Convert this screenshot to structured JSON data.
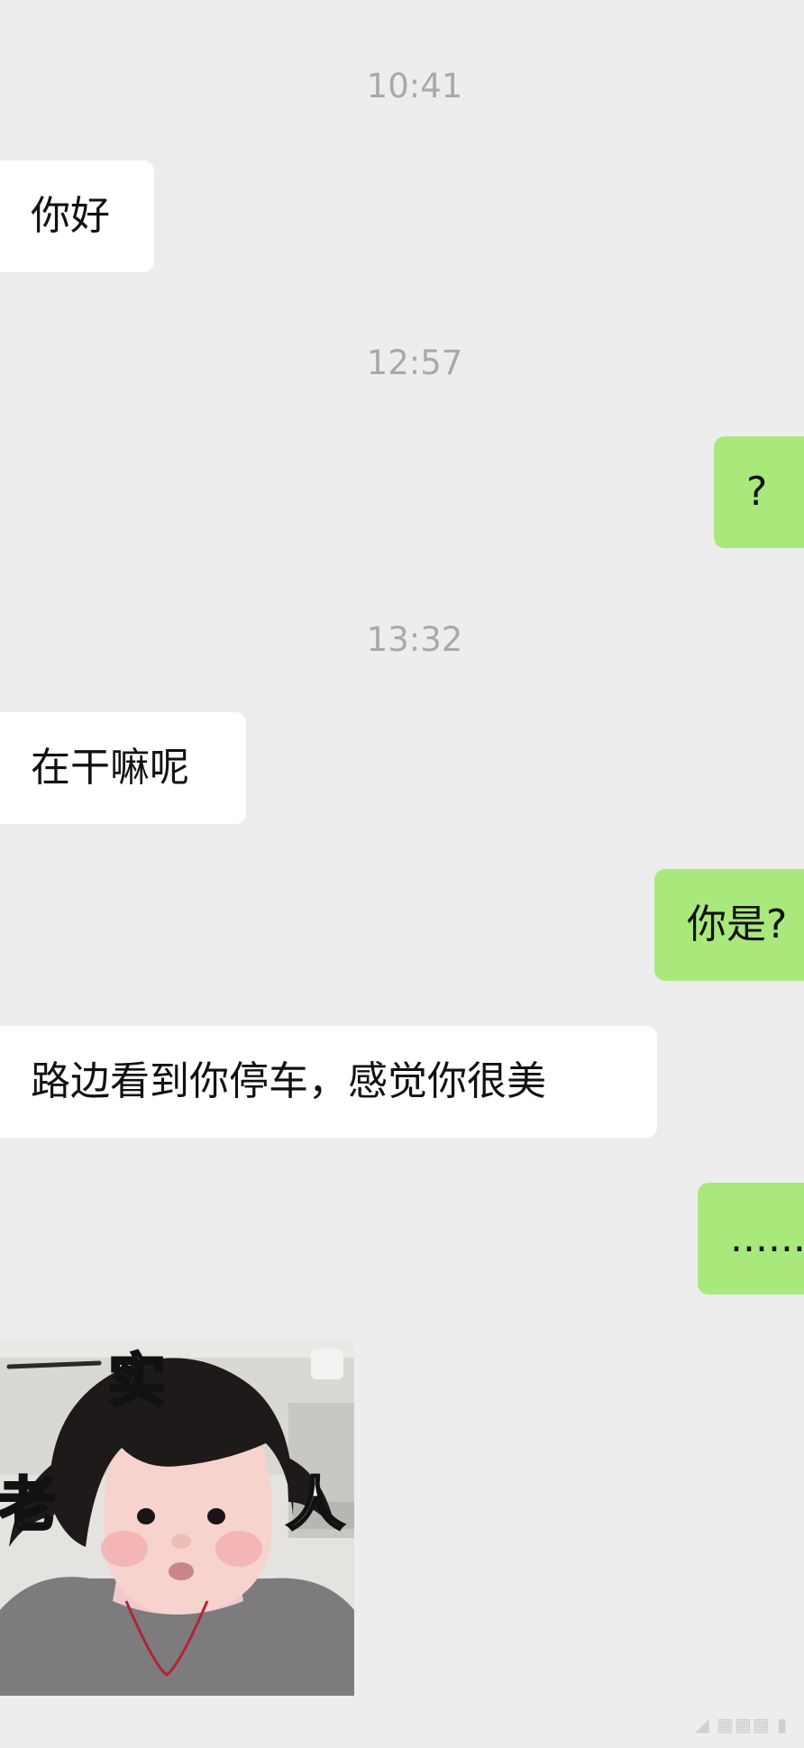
{
  "messages": [
    {
      "type": "time",
      "text": "10:41"
    },
    {
      "type": "incoming",
      "text": "你好"
    },
    {
      "type": "time",
      "text": "12:57"
    },
    {
      "type": "outgoing",
      "text": "?"
    },
    {
      "type": "time",
      "text": "13:32"
    },
    {
      "type": "incoming",
      "text": "在干嘛呢"
    },
    {
      "type": "outgoing",
      "text": "你是?"
    },
    {
      "type": "incoming",
      "text": "路边看到你停车，感觉你很美"
    },
    {
      "type": "outgoing",
      "text": "......"
    }
  ],
  "sticker": {
    "icon": "toddler-meme-sticker",
    "caption_top": "实",
    "caption_left": "老",
    "caption_right": "人"
  },
  "colors": {
    "background": "#ededed",
    "incoming_bubble": "#ffffff",
    "outgoing_bubble": "#a9e97b",
    "timestamp": "#a9a9a9"
  }
}
